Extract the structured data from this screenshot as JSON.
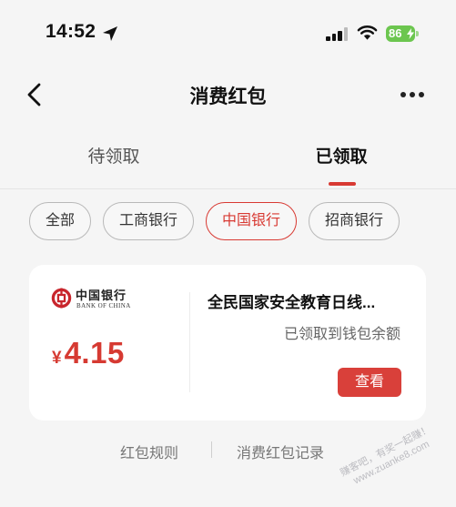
{
  "status_bar": {
    "time": "14:52",
    "battery_level": "86",
    "icons": [
      "location-arrow-icon",
      "signal-icon",
      "wifi-icon",
      "battery-charging-icon"
    ]
  },
  "nav": {
    "title": "消费红包",
    "back_icon": "chevron-left-icon",
    "more_icon": "more-dots-icon"
  },
  "tabs": [
    {
      "label": "待领取",
      "active": false
    },
    {
      "label": "已领取",
      "active": true
    }
  ],
  "filters": [
    {
      "label": "全部",
      "selected": false
    },
    {
      "label": "工商银行",
      "selected": false
    },
    {
      "label": "中国银行",
      "selected": true
    },
    {
      "label": "招商银行",
      "selected": false
    }
  ],
  "red_packet": {
    "bank_logo": {
      "icon": "bank-of-china-logo-icon",
      "name_cn": "中国银行",
      "name_en": "BANK OF CHINA"
    },
    "amount": {
      "currency": "¥",
      "value": "4.15"
    },
    "title": "全民国家安全教育日线...",
    "status": "已领取到钱包余额",
    "action_label": "查看"
  },
  "footer": {
    "rules_link": "红包规则",
    "records_link": "消费红包记录"
  },
  "watermark": {
    "line1": "赚客吧，有奖一起赚！",
    "line2": "www.zuanke8.com"
  },
  "colors": {
    "accent": "#d83a33",
    "battery": "#6cc64f",
    "background": "#f5f5f5",
    "card": "#ffffff"
  }
}
